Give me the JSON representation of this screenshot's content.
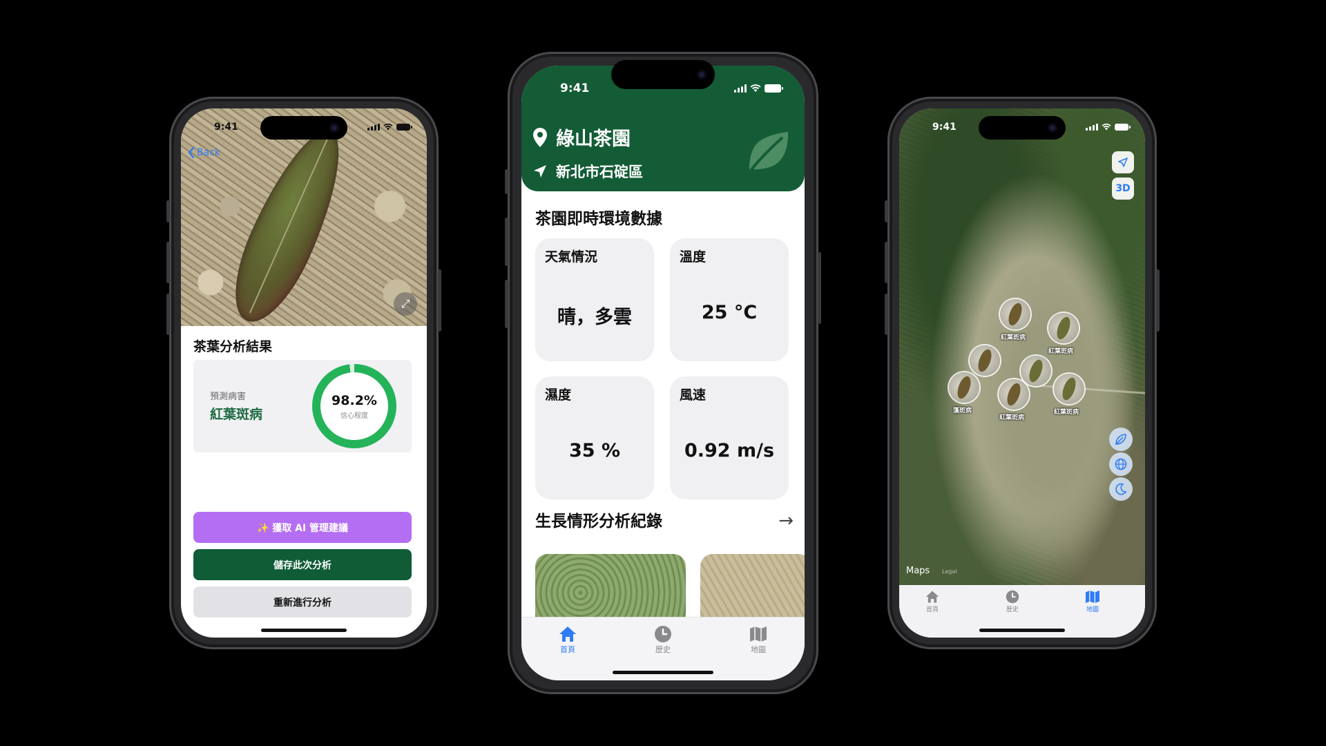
{
  "analysis_screen": {
    "time": "9:41",
    "back_label": "Back",
    "title": "茶葉分析結果",
    "predicted_label": "預測病害",
    "disease": "紅葉斑病",
    "confidence": "98.2%",
    "confidence_value": 0.982,
    "confidence_label": "信心程度",
    "btn_ai": "✨ 獲取 AI 管理建議",
    "btn_save": "儲存此次分析",
    "btn_redo": "重新進行分析"
  },
  "home_screen": {
    "time": "9:41",
    "garden_name": "綠山茶園",
    "location": "新北市石碇區",
    "env_title": "茶園即時環境數據",
    "cards": [
      {
        "title": "天氣情況",
        "value": "晴，多雲"
      },
      {
        "title": "溫度",
        "value": "25 °C"
      },
      {
        "title": "濕度",
        "value": "35 %"
      },
      {
        "title": "風速",
        "value": "0.92 m/s"
      }
    ],
    "growth_title": "生長情形分析紀錄",
    "tabs": [
      {
        "label": "首頁",
        "icon": "house-icon",
        "active": true
      },
      {
        "label": "歷史",
        "icon": "clock-icon",
        "active": false
      },
      {
        "label": "地圖",
        "icon": "map-icon",
        "active": false
      }
    ]
  },
  "map_screen": {
    "time": "9:41",
    "btn_3d": "3D",
    "maps_brand": "Maps",
    "legal": "Legal",
    "pins": [
      {
        "label": "紅葉斑病"
      },
      {
        "label": "紅葉斑病"
      },
      {
        "label": "藻斑病"
      },
      {
        "label": "紅葉斑病"
      },
      {
        "label": "紅葉斑病"
      }
    ],
    "tabs": [
      {
        "label": "首頁",
        "icon": "house-icon",
        "active": false
      },
      {
        "label": "歷史",
        "icon": "clock-icon",
        "active": false
      },
      {
        "label": "地圖",
        "icon": "map-icon",
        "active": true
      }
    ]
  },
  "colors": {
    "brand_green": "#135c36",
    "accent_blue": "#2f7cf6",
    "ai_purple": "#b46ef3",
    "ring_green": "#25b35a"
  }
}
